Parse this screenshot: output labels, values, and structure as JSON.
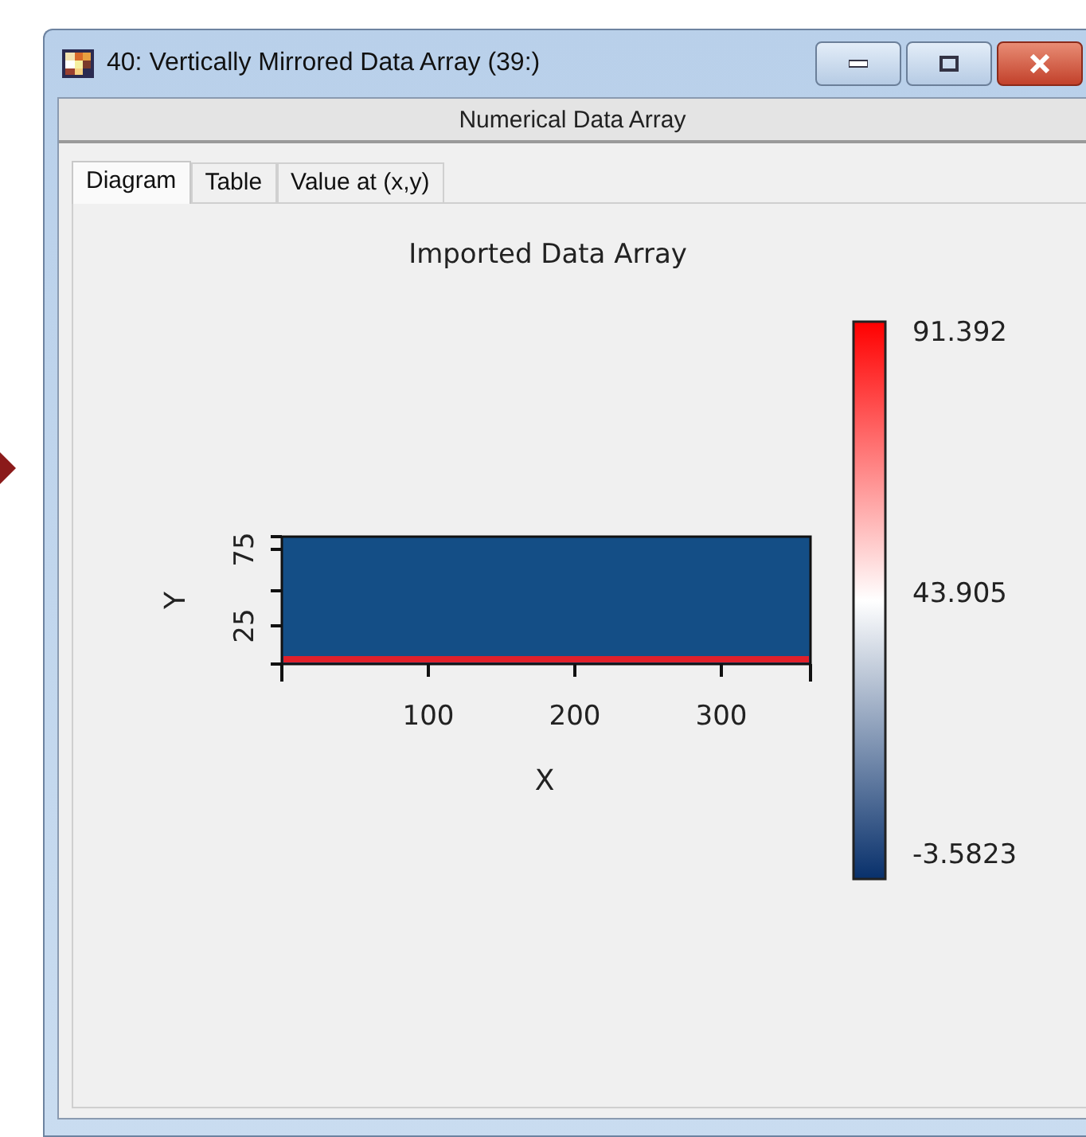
{
  "window": {
    "title": "40: Vertically Mirrored Data Array (39:)"
  },
  "header": "Numerical Data Array",
  "tabs": [
    {
      "label": "Diagram",
      "selected": true
    },
    {
      "label": "Table",
      "selected": false
    },
    {
      "label": "Value at (x,y)",
      "selected": false
    }
  ],
  "plot": {
    "title": "Imported Data Array",
    "xlabel": "X",
    "ylabel": "Y",
    "xticks": [
      "100",
      "200",
      "300"
    ],
    "yticks": [
      "75",
      "25"
    ],
    "colorbar_labels": [
      "91.392",
      "43.905",
      "-3.5823"
    ]
  }
}
